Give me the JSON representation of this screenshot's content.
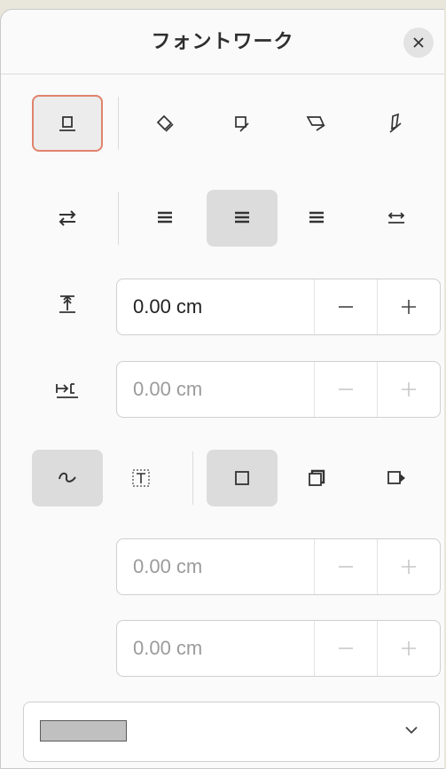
{
  "title": "フォントワーク",
  "icons": {
    "close": "close-icon",
    "orientation": [
      "upright-icon",
      "rotate-icon",
      "slant-horizontal-icon",
      "slant-vertical-icon",
      "slant-italic-icon"
    ],
    "alignment": [
      "orientation-toggle-icon",
      "align-left-icon",
      "align-center-icon",
      "align-right-icon",
      "align-autosize-icon"
    ],
    "spacing": [
      "distance-icon",
      "indent-icon"
    ],
    "shadow": [
      "contour-icon",
      "text-frame-icon",
      "no-shadow-icon",
      "vertical-shadow-icon",
      "slant-shadow-icon"
    ]
  },
  "fields": {
    "distance": {
      "value": "0.00 cm",
      "enabled": true
    },
    "indent": {
      "value": "0.00 cm",
      "enabled": false
    },
    "shadow_x": {
      "value": "0.00 cm",
      "enabled": false
    },
    "shadow_y": {
      "value": "0.00 cm",
      "enabled": false
    }
  },
  "controls": {
    "minus": "−",
    "plus": "+"
  },
  "colors": {
    "accent_focus": "#e0836b",
    "active_bg": "#dcdcdc",
    "shadow_swatch": "#c0c0c0"
  }
}
